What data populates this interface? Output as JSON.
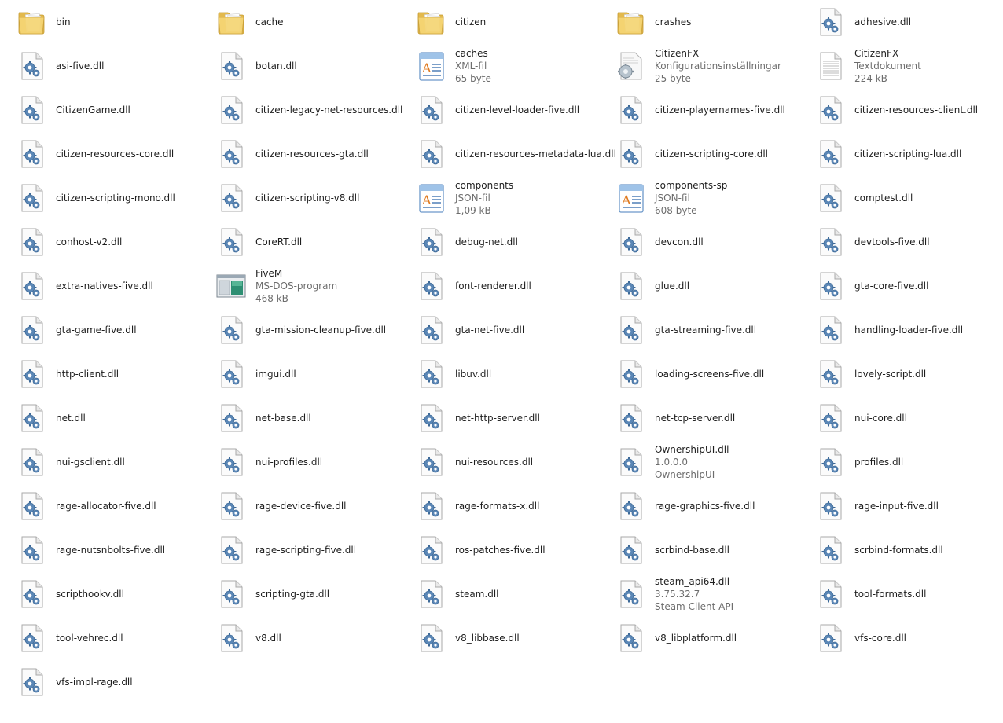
{
  "items": [
    {
      "name": "bin",
      "icon": "folder"
    },
    {
      "name": "cache",
      "icon": "folder"
    },
    {
      "name": "citizen",
      "icon": "folder"
    },
    {
      "name": "crashes",
      "icon": "folder"
    },
    {
      "name": "adhesive.dll",
      "icon": "dll"
    },
    {
      "name": "asi-five.dll",
      "icon": "dll"
    },
    {
      "name": "botan.dll",
      "icon": "dll"
    },
    {
      "name": "caches",
      "icon": "xml",
      "line2": "XML-fil",
      "line3": "65 byte"
    },
    {
      "name": "CitizenFX",
      "icon": "config",
      "line2": "Konfigurationsinställningar",
      "line3": "25 byte"
    },
    {
      "name": "CitizenFX",
      "icon": "text",
      "line2": "Textdokument",
      "line3": "224 kB"
    },
    {
      "name": "CitizenGame.dll",
      "icon": "dll"
    },
    {
      "name": "citizen-legacy-net-resources.dll",
      "icon": "dll"
    },
    {
      "name": "citizen-level-loader-five.dll",
      "icon": "dll"
    },
    {
      "name": "citizen-playernames-five.dll",
      "icon": "dll"
    },
    {
      "name": "citizen-resources-client.dll",
      "icon": "dll"
    },
    {
      "name": "citizen-resources-core.dll",
      "icon": "dll"
    },
    {
      "name": "citizen-resources-gta.dll",
      "icon": "dll"
    },
    {
      "name": "citizen-resources-metadata-lua.dll",
      "icon": "dll"
    },
    {
      "name": "citizen-scripting-core.dll",
      "icon": "dll"
    },
    {
      "name": "citizen-scripting-lua.dll",
      "icon": "dll"
    },
    {
      "name": "citizen-scripting-mono.dll",
      "icon": "dll"
    },
    {
      "name": "citizen-scripting-v8.dll",
      "icon": "dll"
    },
    {
      "name": "components",
      "icon": "xml",
      "line2": "JSON-fil",
      "line3": "1,09 kB"
    },
    {
      "name": "components-sp",
      "icon": "xml",
      "line2": "JSON-fil",
      "line3": "608 byte"
    },
    {
      "name": "comptest.dll",
      "icon": "dll"
    },
    {
      "name": "conhost-v2.dll",
      "icon": "dll"
    },
    {
      "name": "CoreRT.dll",
      "icon": "dll"
    },
    {
      "name": "debug-net.dll",
      "icon": "dll"
    },
    {
      "name": "devcon.dll",
      "icon": "dll"
    },
    {
      "name": "devtools-five.dll",
      "icon": "dll"
    },
    {
      "name": "extra-natives-five.dll",
      "icon": "dll"
    },
    {
      "name": "FiveM",
      "icon": "exe",
      "line2": "MS-DOS-program",
      "line3": "468 kB"
    },
    {
      "name": "font-renderer.dll",
      "icon": "dll"
    },
    {
      "name": "glue.dll",
      "icon": "dll"
    },
    {
      "name": "gta-core-five.dll",
      "icon": "dll"
    },
    {
      "name": "gta-game-five.dll",
      "icon": "dll"
    },
    {
      "name": "gta-mission-cleanup-five.dll",
      "icon": "dll"
    },
    {
      "name": "gta-net-five.dll",
      "icon": "dll"
    },
    {
      "name": "gta-streaming-five.dll",
      "icon": "dll"
    },
    {
      "name": "handling-loader-five.dll",
      "icon": "dll"
    },
    {
      "name": "http-client.dll",
      "icon": "dll"
    },
    {
      "name": "imgui.dll",
      "icon": "dll"
    },
    {
      "name": "libuv.dll",
      "icon": "dll"
    },
    {
      "name": "loading-screens-five.dll",
      "icon": "dll"
    },
    {
      "name": "lovely-script.dll",
      "icon": "dll"
    },
    {
      "name": "net.dll",
      "icon": "dll"
    },
    {
      "name": "net-base.dll",
      "icon": "dll"
    },
    {
      "name": "net-http-server.dll",
      "icon": "dll"
    },
    {
      "name": "net-tcp-server.dll",
      "icon": "dll"
    },
    {
      "name": "nui-core.dll",
      "icon": "dll"
    },
    {
      "name": "nui-gsclient.dll",
      "icon": "dll"
    },
    {
      "name": "nui-profiles.dll",
      "icon": "dll"
    },
    {
      "name": "nui-resources.dll",
      "icon": "dll"
    },
    {
      "name": "OwnershipUI.dll",
      "icon": "dll",
      "line2": "1.0.0.0",
      "line3": "OwnershipUI"
    },
    {
      "name": "profiles.dll",
      "icon": "dll"
    },
    {
      "name": "rage-allocator-five.dll",
      "icon": "dll"
    },
    {
      "name": "rage-device-five.dll",
      "icon": "dll"
    },
    {
      "name": "rage-formats-x.dll",
      "icon": "dll"
    },
    {
      "name": "rage-graphics-five.dll",
      "icon": "dll"
    },
    {
      "name": "rage-input-five.dll",
      "icon": "dll"
    },
    {
      "name": "rage-nutsnbolts-five.dll",
      "icon": "dll"
    },
    {
      "name": "rage-scripting-five.dll",
      "icon": "dll"
    },
    {
      "name": "ros-patches-five.dll",
      "icon": "dll"
    },
    {
      "name": "scrbind-base.dll",
      "icon": "dll"
    },
    {
      "name": "scrbind-formats.dll",
      "icon": "dll"
    },
    {
      "name": "scripthookv.dll",
      "icon": "dll"
    },
    {
      "name": "scripting-gta.dll",
      "icon": "dll"
    },
    {
      "name": "steam.dll",
      "icon": "dll"
    },
    {
      "name": "steam_api64.dll",
      "icon": "dll",
      "line2": "3.75.32.7",
      "line3": "Steam Client API"
    },
    {
      "name": "tool-formats.dll",
      "icon": "dll"
    },
    {
      "name": "tool-vehrec.dll",
      "icon": "dll"
    },
    {
      "name": "v8.dll",
      "icon": "dll"
    },
    {
      "name": "v8_libbase.dll",
      "icon": "dll"
    },
    {
      "name": "v8_libplatform.dll",
      "icon": "dll"
    },
    {
      "name": "vfs-core.dll",
      "icon": "dll"
    },
    {
      "name": "vfs-impl-rage.dll",
      "icon": "dll"
    }
  ],
  "colors": {
    "folder_back": "#e8c157",
    "folder_front": "#f7d87a",
    "gear": "#4d7fb0",
    "text_secondary": "#6d6d6d"
  }
}
